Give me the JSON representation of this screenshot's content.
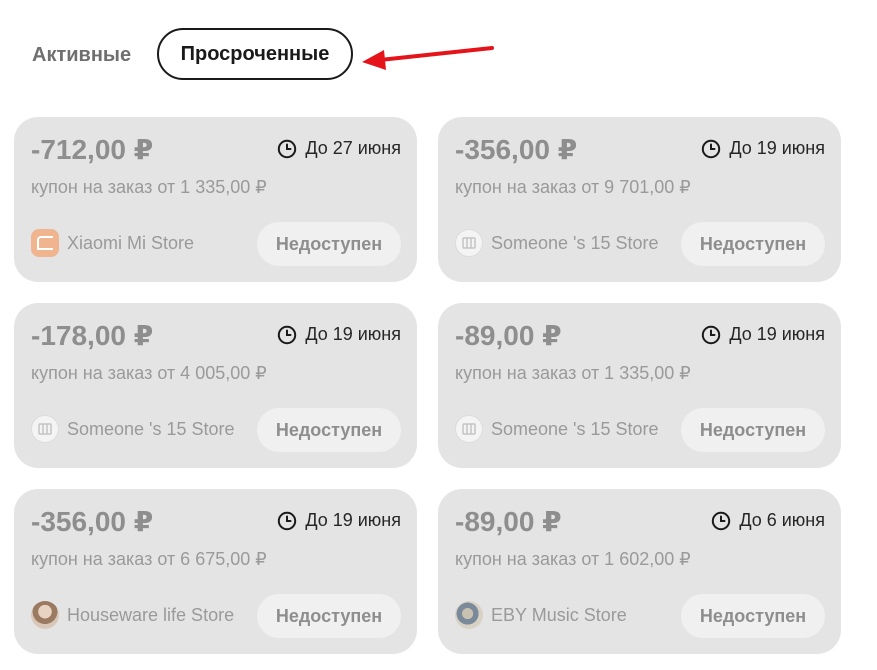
{
  "tabs": {
    "active_label": "Активные",
    "expired_label": "Просроченные"
  },
  "colors": {
    "card_bg": "#e4e4e4",
    "arrow": "#e5131a",
    "muted_text": "#8e8e8e"
  },
  "coupons": [
    {
      "amount": "-712,00 ₽",
      "deadline": "До 27 июня",
      "condition": "купон на заказ от 1 335,00 ₽",
      "store": "Xiaomi Mi Store",
      "store_icon": "xiaomi-logo",
      "status": "Недоступен"
    },
    {
      "amount": "-356,00 ₽",
      "deadline": "До 19 июня",
      "condition": "купон на заказ от 9 701,00 ₽",
      "store": "Someone 's 15 Store",
      "store_icon": "store-icon",
      "status": "Недоступен"
    },
    {
      "amount": "-178,00 ₽",
      "deadline": "До 19 июня",
      "condition": "купон на заказ от 4 005,00 ₽",
      "store": "Someone 's 15 Store",
      "store_icon": "store-icon",
      "status": "Недоступен"
    },
    {
      "amount": "-89,00 ₽",
      "deadline": "До 19 июня",
      "condition": "купон на заказ от 1 335,00 ₽",
      "store": "Someone 's 15 Store",
      "store_icon": "store-icon",
      "status": "Недоступен"
    },
    {
      "amount": "-356,00 ₽",
      "deadline": "До 19 июня",
      "condition": "купон на заказ от 6 675,00 ₽",
      "store": "Houseware life Store",
      "store_icon": "store-avatar-photo",
      "status": "Недоступен"
    },
    {
      "amount": "-89,00 ₽",
      "deadline": "До 6 июня",
      "condition": "купон на заказ от 1 602,00 ₽",
      "store": "EBY Music Store",
      "store_icon": "store-avatar-photo",
      "status": "Недоступен"
    }
  ]
}
